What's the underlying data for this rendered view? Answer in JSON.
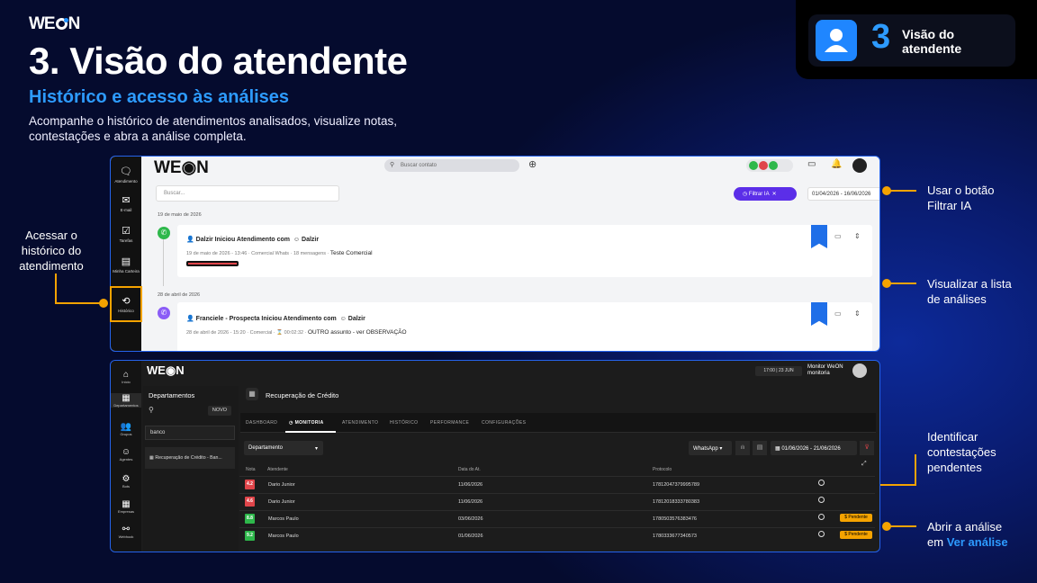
{
  "brand": "WEON",
  "title": "3. Visão do atendente",
  "subtitle": "Histórico e acesso às análises",
  "description": "Acompanhe o histórico de atendimentos analisados, visualize notas, contestações e abra a análise completa.",
  "badge": {
    "number": "3",
    "line1": "Visão do",
    "line2": "atendente"
  },
  "callouts": {
    "left": [
      "Acessar o",
      "histórico do",
      "atendimento"
    ],
    "c1": [
      "Usar o botão",
      "Filtrar IA"
    ],
    "c2": [
      "Visualizar a lista",
      "de análises"
    ],
    "c3": [
      "Identificar",
      "contestações",
      "pendentes"
    ],
    "c4_prefix": "Abrir a análise",
    "c4_em": "em",
    "c4_link": "Ver análise"
  },
  "screen1": {
    "sidebar": [
      "Atendimento",
      "E-mail",
      "Tarefas",
      "Minha Carteira",
      "Histórico"
    ],
    "search_placeholder": "Buscar contato",
    "buscar_placeholder": "Buscar...",
    "filter_btn": "Filtrar IA",
    "date_range": "01/04/2026 - 16/06/2026",
    "date1": "19 de maio de 2026",
    "card1": {
      "title": "Dalzir Iniciou Atendimento com",
      "agent": "Dalzir",
      "meta": "19 de maio de 2026 - 13:46",
      "channel": "Comercial Whats",
      "msgs": "18 mensagens",
      "tag": "Teste Comercial"
    },
    "date2": "28 de abril de 2026",
    "card2": {
      "title": "Franciele - Prospecta Iniciou Atendimento com",
      "agent": "Dalzir",
      "meta": "28 de abril de 2026 - 15:20",
      "channel": "Comercial",
      "dur": "00:02:32",
      "tag": "OUTRO assunto - ver OBSERVAÇÃO"
    }
  },
  "screen2": {
    "sidebar": [
      "Início",
      "Departamentos",
      "Grupos",
      "Agentes",
      "Bots",
      "Empresas",
      "Webhook"
    ],
    "time": "17:00 | 23 JUN",
    "user": "Monitor WeON",
    "role": "monitoria",
    "panel_title": "Departamentos",
    "novo": "NOVO",
    "dept_search": "banco",
    "dept_item": "Recuperação de Crédito - Ban...",
    "page_title": "Recuperação de Crédito",
    "tabs": [
      "DASHBOARD",
      "MONITORIA",
      "ATENDIMENTO",
      "HISTÓRICO",
      "PERFORMANCE",
      "CONFIGURAÇÕES"
    ],
    "dept_select": "Departamento",
    "channel_select": "WhatsApp",
    "range": "01/06/2026 - 21/06/2026",
    "columns": [
      "Nota",
      "Atendente",
      "Data do At.",
      "Protocolo"
    ],
    "rows": [
      {
        "nota": "4.2",
        "color": "#e0454a",
        "atendente": "Dario Junior",
        "data": "11/06/2026",
        "protocolo": "17812047379995789",
        "pend": ""
      },
      {
        "nota": "4.6",
        "color": "#e0454a",
        "atendente": "Dario Junior",
        "data": "11/06/2026",
        "protocolo": "17812018333780383",
        "pend": ""
      },
      {
        "nota": "8.8",
        "color": "#2eb84b",
        "atendente": "Marcos Paulo",
        "data": "03/06/2026",
        "protocolo": "17805035763834​76",
        "pend": "$ Pendente"
      },
      {
        "nota": "9.2",
        "color": "#2eb84b",
        "atendente": "Marcos Paulo",
        "data": "01/06/2026",
        "protocolo": "17803336773405​73",
        "pend": "$ Pendente"
      }
    ]
  }
}
